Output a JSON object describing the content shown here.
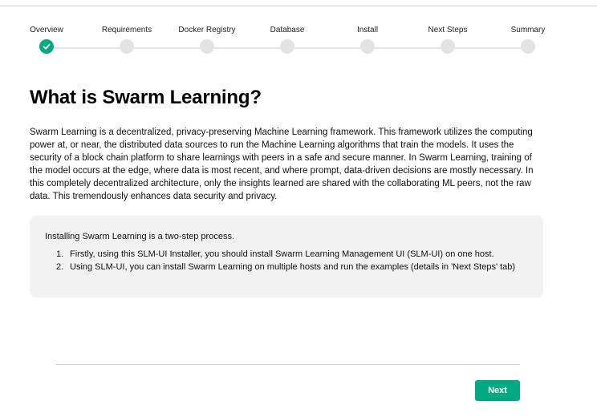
{
  "stepper": {
    "steps": [
      {
        "label": "Overview",
        "state": "completed"
      },
      {
        "label": "Requirements",
        "state": "pending"
      },
      {
        "label": "Docker Registry",
        "state": "pending"
      },
      {
        "label": "Database",
        "state": "pending"
      },
      {
        "label": "Install",
        "state": "pending"
      },
      {
        "label": "Next Steps",
        "state": "pending"
      },
      {
        "label": "Summary",
        "state": "pending"
      }
    ],
    "completed_icon": "checkmark-icon"
  },
  "main": {
    "title": "What is Swarm Learning?",
    "description": "Swarm Learning is a decentralized, privacy-preserving Machine Learning framework. This framework utilizes the computing power at, or near, the distributed data sources to run the Machine Learning algorithms that train the models. It uses the security of a block chain platform to share learnings with peers in a safe and secure manner. In Swarm Learning, training of the model occurs at the edge, where data is most recent, and where prompt, data-driven decisions are mostly necessary. In this completely decentralized architecture, only the insights learned are shared with the collaborating ML peers, not the raw data. This tremendously enhances data security and privacy.",
    "note": {
      "intro": "Installing Swarm Learning is a two-step process.",
      "items": [
        {
          "number": "1.",
          "text": "Firstly, using this SLM-UI Installer, you should install Swarm Learning Management UI (SLM-UI) on one host."
        },
        {
          "number": "2.",
          "text": "Using SLM-UI, you can install Swarm Learning on multiple hosts and run the examples (details in 'Next Steps' tab)"
        }
      ]
    }
  },
  "footer": {
    "next_label": "Next"
  },
  "colors": {
    "accent": "#01a982",
    "pending_dot": "#e3e3e3",
    "note_background": "#f2f2f2"
  }
}
